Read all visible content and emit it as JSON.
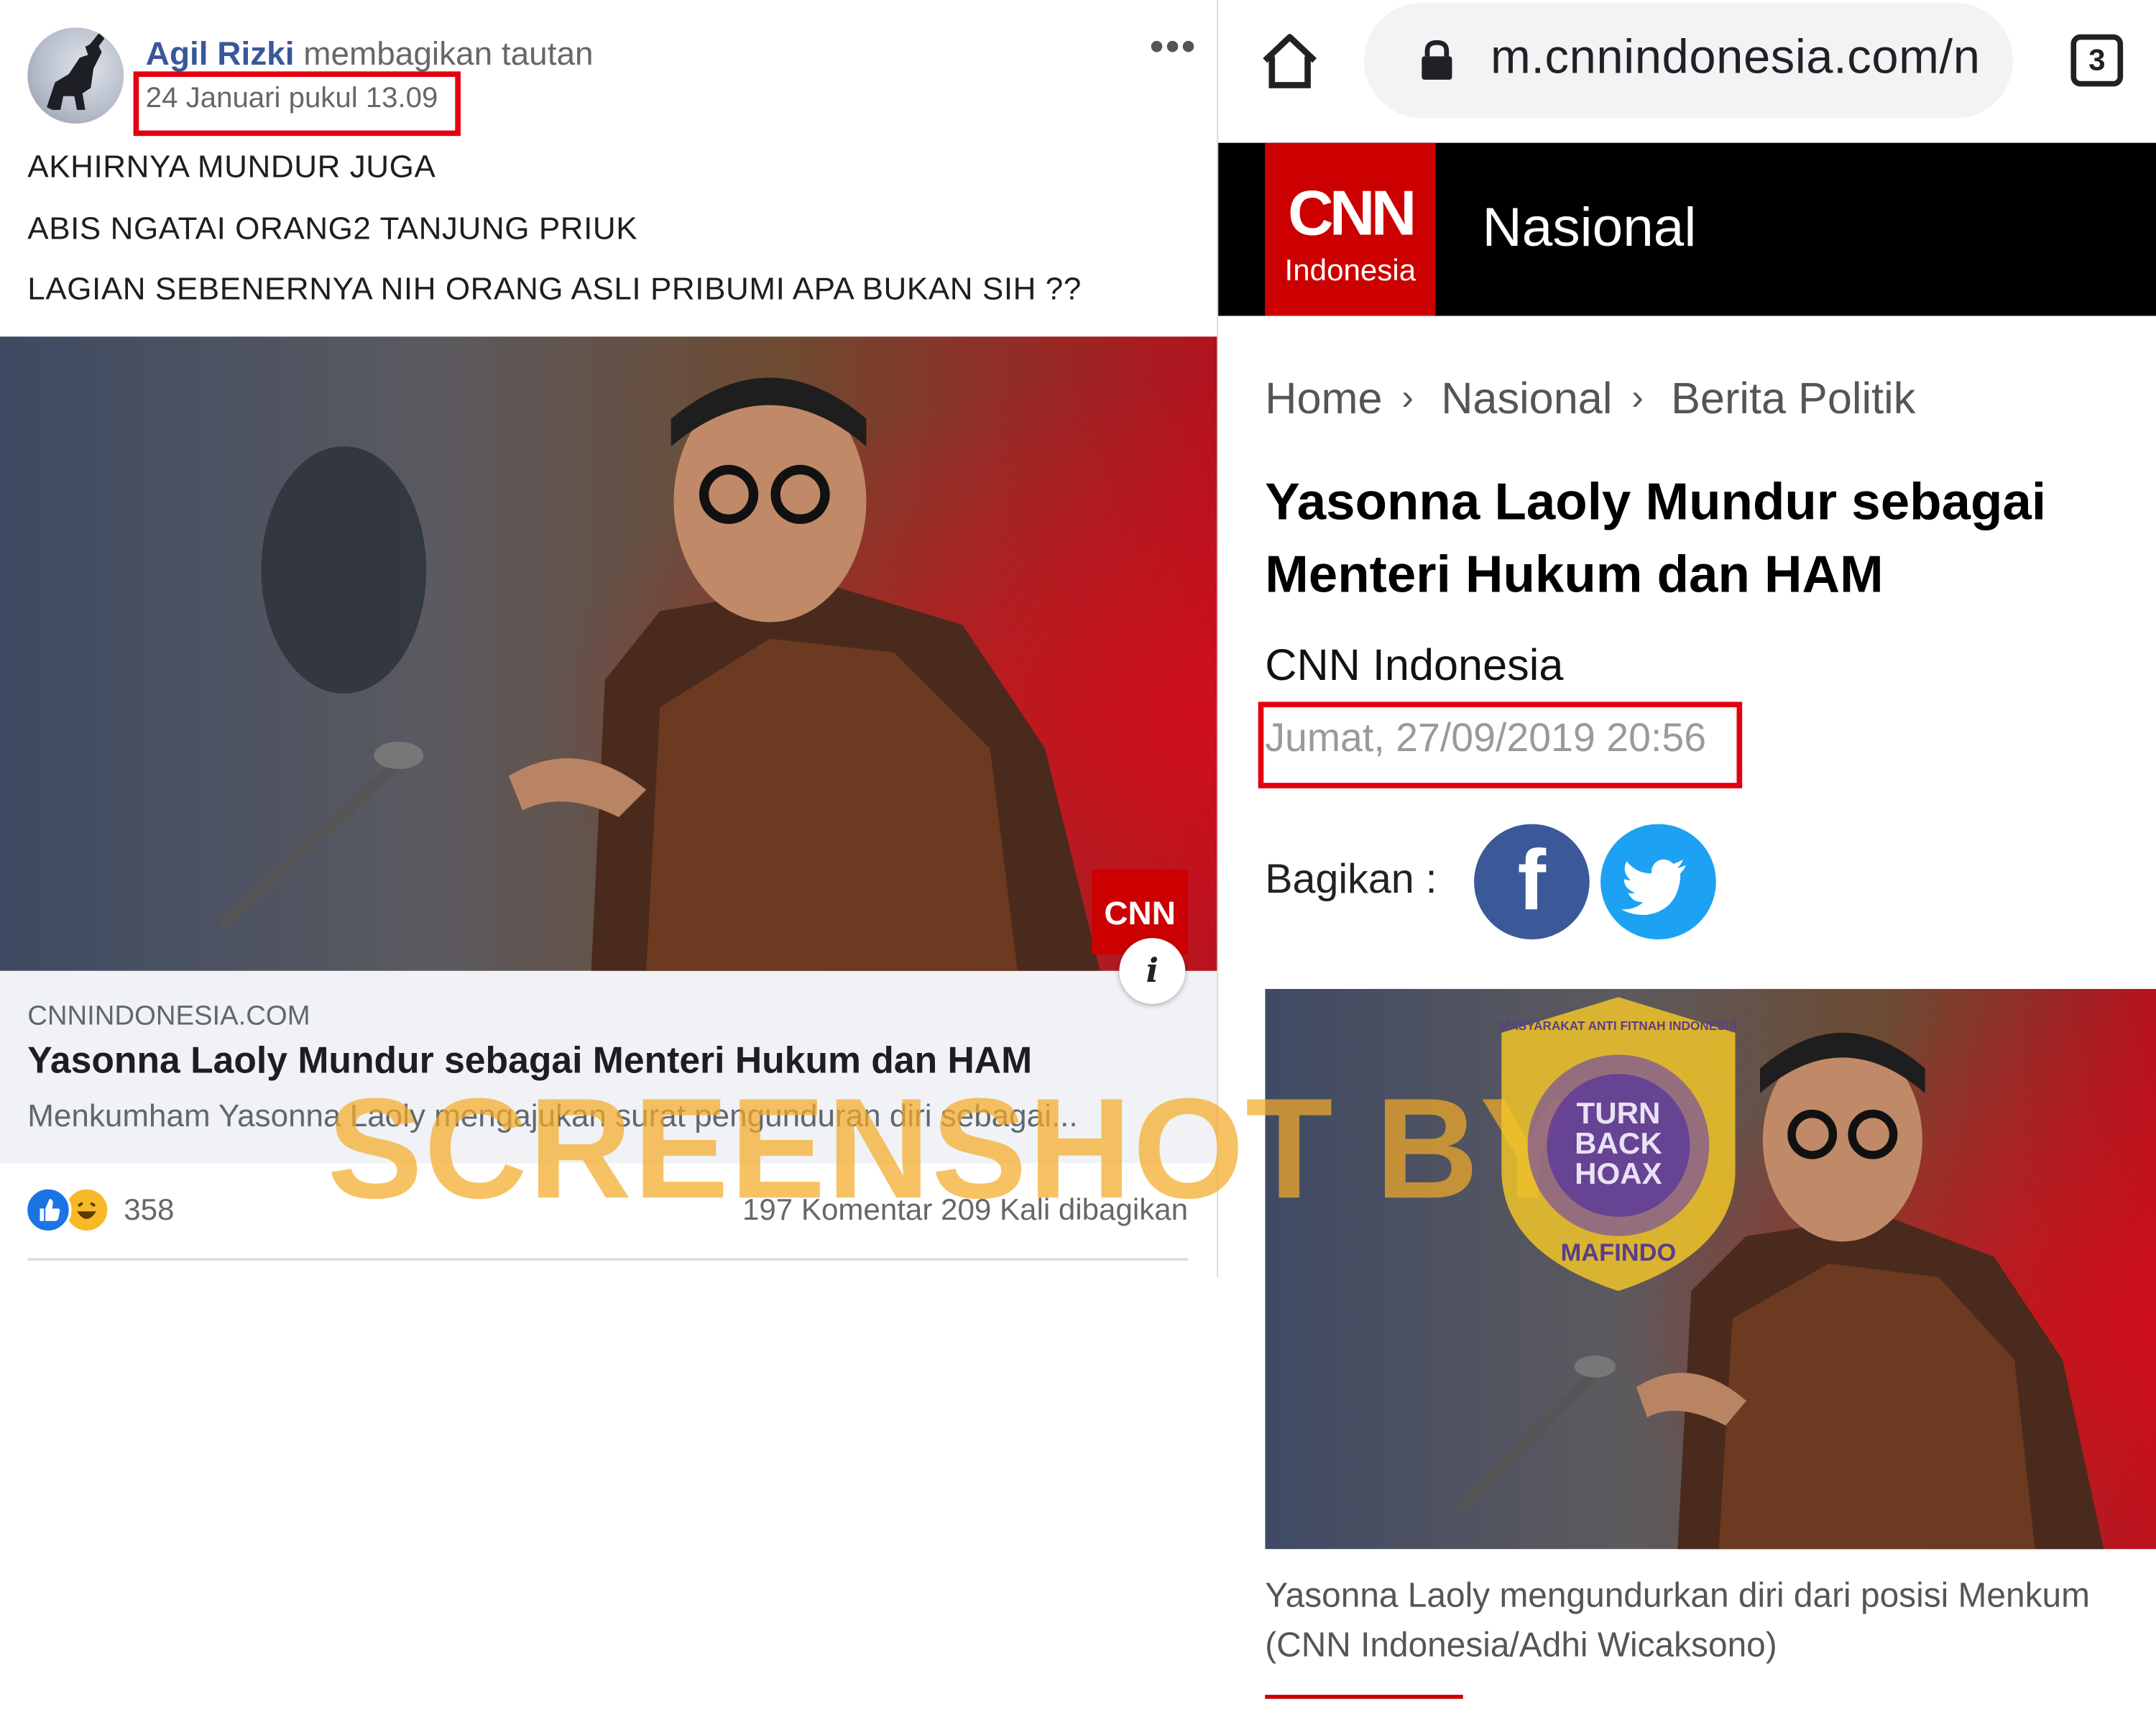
{
  "facebook_post": {
    "author_name": "Agil Rizki",
    "action_text": " membagikan tautan",
    "timestamp": "24 Januari pukul 13.09",
    "more_icon": "more-options-icon",
    "text_lines": [
      "AKHIRNYA MUNDUR JUGA",
      "ABIS NGATAI ORANG2 TANJUNG PRIUK",
      "LAGIAN SEBENERNYA NIH ORANG ASLI PRIBUMI APA BUKAN SIH ??"
    ],
    "link_preview": {
      "domain": "CNNINDONESIA.COM",
      "title": "Yasonna Laoly Mundur sebagai Menteri Hukum dan HAM",
      "description": "Menkumham Yasonna Laoly mengajukan surat pengunduran diri sebagai...",
      "info_glyph": "i"
    },
    "reactions": {
      "icons": [
        "like-icon",
        "haha-icon"
      ],
      "count": "358"
    },
    "comments_shares": "197 Komentar  209 Kali dibagikan"
  },
  "browser": {
    "url": "m.cnnindonesia.com/n",
    "tab_count": "3"
  },
  "cnn_page": {
    "logo_mark": "CNN",
    "logo_sub": "Indonesia",
    "section": "Nasional",
    "breadcrumb": [
      "Home",
      "Nasional",
      "Berita Politik"
    ],
    "breadcrumb_separator": "›",
    "headline": "Yasonna Laoly Mundur sebagai Menteri Hukum dan HAM",
    "byline": "CNN Indonesia",
    "date": "Jumat, 27/09/2019 20:56",
    "share_label": "Bagikan :",
    "share_fb_glyph": "f",
    "caption_lines": [
      "Yasonna Laoly mengundurkan diri dari posisi Menkum",
      "(CNN Indonesia/Adhi Wicaksono)"
    ]
  },
  "watermark": {
    "text": "SCREENSHOT BY",
    "badge_lines": [
      "TURN",
      "BACK",
      "HOAX"
    ],
    "badge_ring_top": "MASYARAKAT ANTI FITNAH INDONESIA",
    "badge_ring_bottom": "MAFINDO"
  },
  "colors": {
    "facebook_blue": "#385898",
    "cnn_red": "#cc0000",
    "highlight_red": "#e3000f",
    "watermark_orange": "#f4aa28"
  }
}
